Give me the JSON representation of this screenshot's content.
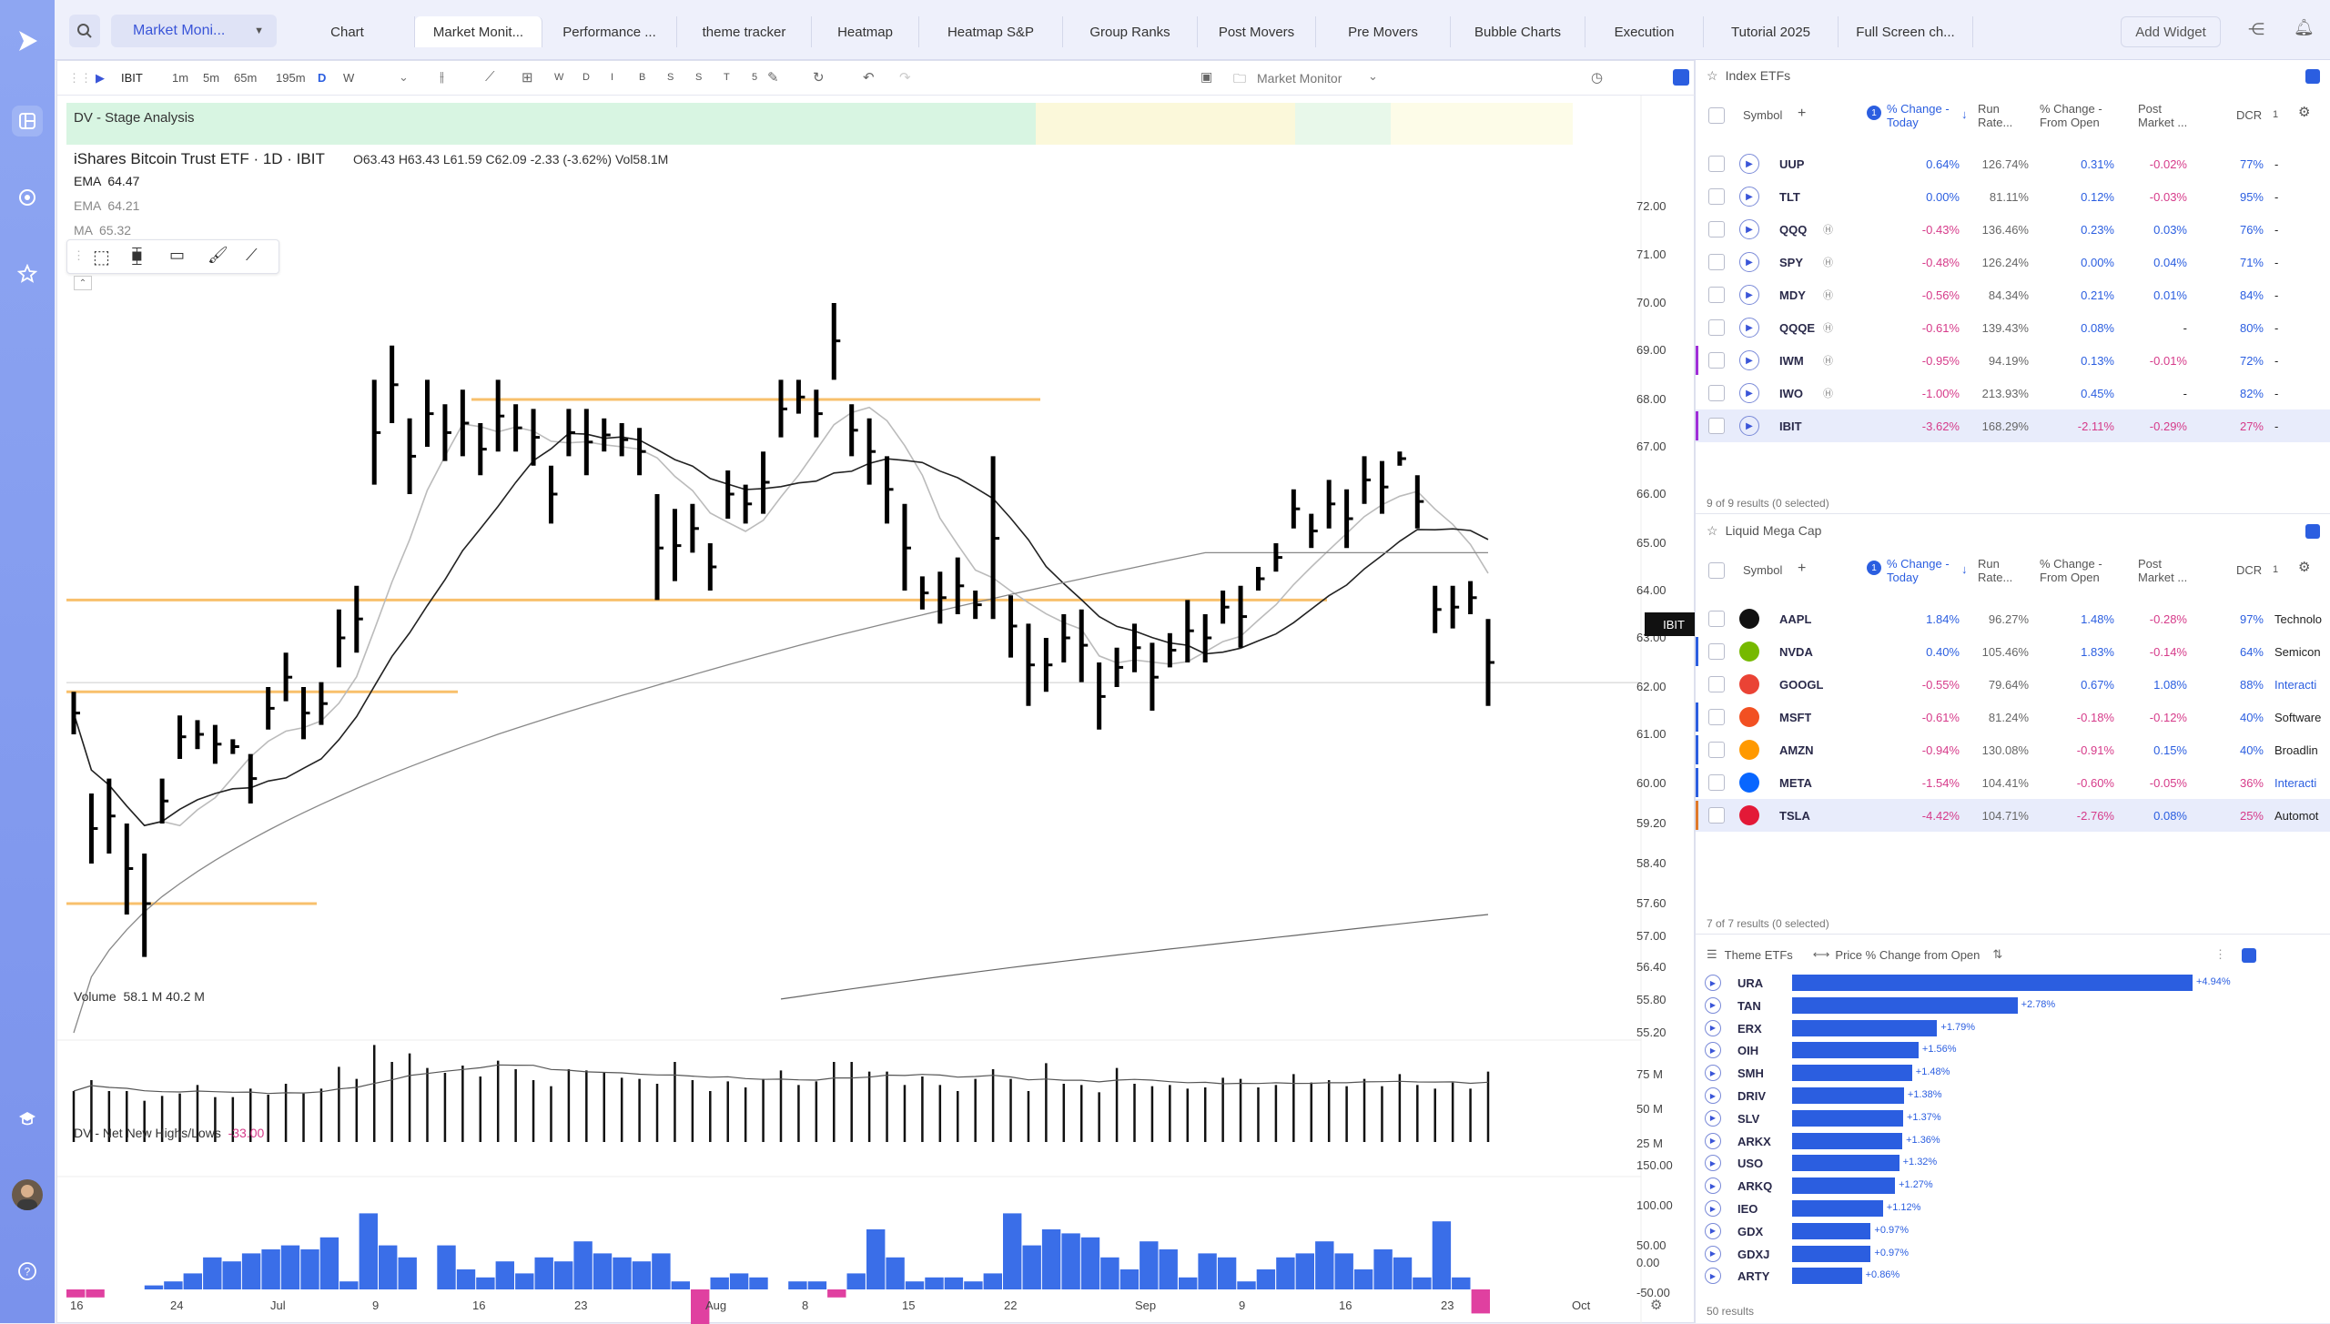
{
  "sidebar": {
    "logo": "play-logo-icon",
    "items": [
      "dashboard-icon",
      "target-icon",
      "star-icon",
      "graduation-cap-icon",
      "avatar",
      "help-icon"
    ]
  },
  "topbar": {
    "layout_selector": "Market Moni...",
    "tabs": [
      "Chart",
      "Market Monit...",
      "Performance ...",
      "theme tracker",
      "Heatmap",
      "Heatmap S&P",
      "Group Ranks",
      "Post Movers",
      "Pre Movers",
      "Bubble Charts",
      "Execution",
      "Tutorial 2025",
      "Full Screen ch..."
    ],
    "active_tab": "Market Monit...",
    "add_widget": "Add Widget"
  },
  "chart": {
    "toolbar": {
      "symbol": "IBIT",
      "intervals": [
        "1m",
        "5m",
        "65m",
        "195m",
        "D",
        "W"
      ],
      "active_interval": "D",
      "tool_letters": [
        "W",
        "D",
        "I",
        "B",
        "S",
        "S",
        "T",
        "5"
      ],
      "layout_name": "Market Monitor"
    },
    "stage_label": "DV - Stage Analysis",
    "title": "iShares Bitcoin Trust ETF · 1D · IBIT",
    "ohlc": "O63.43  H63.43  L61.59  C62.09  -2.33 (-3.62%)  Vol58.1M",
    "indicators": [
      {
        "name": "EMA",
        "value": "64.47"
      },
      {
        "name": "EMA",
        "value": "64.21"
      },
      {
        "name": "MA",
        "value": "65.32"
      }
    ],
    "price_tag": "IBIT",
    "y_axis": [
      "72.00",
      "71.00",
      "70.00",
      "69.00",
      "68.00",
      "67.00",
      "66.00",
      "65.00",
      "64.00",
      "63.00",
      "62.00",
      "61.00",
      "60.00",
      "59.20",
      "58.40",
      "57.60",
      "57.00",
      "56.40",
      "55.80",
      "55.20"
    ],
    "x_axis": [
      "16",
      "24",
      "Jul",
      "9",
      "16",
      "23",
      "Aug",
      "8",
      "15",
      "22",
      "Sep",
      "9",
      "16",
      "23",
      "Oct"
    ],
    "volume_label": "Volume",
    "volume_values": "58.1 M   40.2 M",
    "volume_axis": [
      "75 M",
      "50 M",
      "25 M"
    ],
    "nnh_label": "DV - Net New Highs/Lows",
    "nnh_value": "-33.00",
    "nnh_axis": [
      "150.00",
      "100.00",
      "50.00",
      "0.00",
      "-50.00"
    ]
  },
  "chart_data": {
    "type": "ohlc",
    "title": "iShares Bitcoin Trust ETF · 1D · IBIT",
    "y_range": [
      55.2,
      72
    ],
    "support_lines": [
      68.0,
      63.8,
      61.9,
      57.6
    ],
    "bars": [
      [
        61.9,
        61.0
      ],
      [
        59.8,
        58.4
      ],
      [
        60.1,
        58.6
      ],
      [
        59.2,
        57.4
      ],
      [
        58.6,
        56.6
      ],
      [
        60.1,
        59.2
      ],
      [
        61.4,
        60.5
      ],
      [
        61.3,
        60.7
      ],
      [
        61.2,
        60.4
      ],
      [
        60.9,
        60.6
      ],
      [
        60.6,
        59.6
      ],
      [
        62.0,
        61.1
      ],
      [
        62.7,
        61.7
      ],
      [
        62.0,
        60.9
      ],
      [
        62.1,
        61.2
      ],
      [
        63.6,
        62.4
      ],
      [
        64.1,
        62.7
      ],
      [
        68.4,
        66.2
      ],
      [
        69.1,
        67.5
      ],
      [
        67.6,
        66.0
      ],
      [
        68.4,
        67.0
      ],
      [
        67.9,
        66.7
      ],
      [
        68.2,
        66.8
      ],
      [
        67.5,
        66.4
      ],
      [
        68.4,
        66.9
      ],
      [
        67.9,
        66.9
      ],
      [
        67.8,
        66.6
      ],
      [
        66.6,
        65.4
      ],
      [
        67.8,
        66.8
      ],
      [
        67.8,
        66.4
      ],
      [
        67.6,
        66.9
      ],
      [
        67.5,
        66.8
      ],
      [
        67.4,
        66.4
      ],
      [
        66.0,
        63.8
      ],
      [
        65.7,
        64.2
      ],
      [
        65.8,
        64.8
      ],
      [
        65.0,
        64.0
      ],
      [
        66.5,
        65.5
      ],
      [
        66.2,
        65.4
      ],
      [
        66.9,
        65.6
      ],
      [
        68.4,
        67.2
      ],
      [
        68.4,
        67.7
      ],
      [
        68.2,
        67.2
      ],
      [
        70.0,
        68.4
      ],
      [
        67.9,
        66.8
      ],
      [
        67.6,
        66.2
      ],
      [
        66.8,
        65.4
      ],
      [
        65.8,
        64.0
      ],
      [
        64.3,
        63.6
      ],
      [
        64.4,
        63.3
      ],
      [
        64.7,
        63.5
      ],
      [
        64.0,
        63.4
      ],
      [
        66.8,
        63.4
      ],
      [
        63.9,
        62.6
      ],
      [
        63.3,
        61.6
      ],
      [
        63.0,
        61.9
      ],
      [
        63.5,
        62.5
      ],
      [
        63.6,
        62.1
      ],
      [
        62.5,
        61.1
      ],
      [
        62.8,
        62.0
      ],
      [
        63.3,
        62.3
      ],
      [
        62.9,
        61.5
      ],
      [
        63.1,
        62.4
      ],
      [
        63.8,
        62.5
      ],
      [
        63.5,
        62.5
      ],
      [
        64.0,
        63.3
      ],
      [
        64.1,
        62.8
      ],
      [
        64.5,
        64.0
      ],
      [
        65.0,
        64.4
      ],
      [
        66.1,
        65.3
      ],
      [
        65.6,
        64.9
      ],
      [
        66.3,
        65.3
      ],
      [
        66.1,
        64.9
      ],
      [
        66.8,
        65.8
      ],
      [
        66.7,
        65.6
      ],
      [
        66.9,
        66.6
      ],
      [
        66.4,
        65.3
      ],
      [
        64.1,
        63.1
      ],
      [
        64.1,
        63.2
      ],
      [
        64.2,
        63.5
      ],
      [
        63.4,
        61.6
      ]
    ],
    "volume": [
      42,
      51,
      42,
      42,
      34,
      38,
      40,
      47,
      37,
      37,
      44,
      39,
      48,
      40,
      44,
      62,
      52,
      80,
      66,
      73,
      61,
      57,
      63,
      54,
      67,
      60,
      51,
      46,
      60,
      59,
      57,
      53,
      52,
      48,
      66,
      51,
      42,
      50,
      45,
      52,
      59,
      47,
      50,
      66,
      66,
      58,
      58,
      47,
      54,
      47,
      42,
      52,
      60,
      52,
      42,
      65,
      48,
      47,
      41,
      61,
      48,
      46,
      47,
      44,
      45,
      53,
      52,
      45,
      47,
      56,
      49,
      51,
      46,
      52,
      46,
      56,
      47,
      44,
      49,
      44,
      58
    ],
    "net_new_highs": [
      -10,
      -10,
      0,
      0,
      5,
      10,
      20,
      40,
      35,
      45,
      50,
      55,
      50,
      65,
      10,
      95,
      55,
      40,
      0,
      55,
      25,
      15,
      35,
      20,
      40,
      35,
      60,
      45,
      40,
      35,
      45,
      10,
      -60,
      15,
      20,
      15,
      0,
      10,
      10,
      -10,
      20,
      75,
      40,
      10,
      15,
      15,
      10,
      20,
      95,
      55,
      75,
      70,
      65,
      40,
      25,
      60,
      50,
      15,
      45,
      40,
      10,
      25,
      40,
      45,
      60,
      45,
      25,
      50,
      40,
      15,
      85,
      15,
      -30
    ]
  },
  "index_etfs": {
    "title": "Index ETFs",
    "columns": [
      "Symbol",
      "% Change - Today",
      "Run Rate...",
      "% Change - From Open",
      "Post Market ...",
      "DCR",
      "1"
    ],
    "rows": [
      {
        "sym": "UUP",
        "chg": "0.64%",
        "run": "126.74%",
        "open": "0.31%",
        "post": "-0.02%",
        "dcr": "77%",
        "extra": "-",
        "badge": false
      },
      {
        "sym": "TLT",
        "chg": "0.00%",
        "run": "81.11%",
        "open": "0.12%",
        "post": "-0.03%",
        "dcr": "95%",
        "extra": "-",
        "badge": false
      },
      {
        "sym": "QQQ",
        "chg": "-0.43%",
        "run": "136.46%",
        "open": "0.23%",
        "post": "0.03%",
        "dcr": "76%",
        "extra": "-",
        "badge": true
      },
      {
        "sym": "SPY",
        "chg": "-0.48%",
        "run": "126.24%",
        "open": "0.00%",
        "post": "0.04%",
        "dcr": "71%",
        "extra": "-",
        "badge": true
      },
      {
        "sym": "MDY",
        "chg": "-0.56%",
        "run": "84.34%",
        "open": "0.21%",
        "post": "0.01%",
        "dcr": "84%",
        "extra": "-",
        "badge": true
      },
      {
        "sym": "QQQE",
        "chg": "-0.61%",
        "run": "139.43%",
        "open": "0.08%",
        "post": "-",
        "dcr": "80%",
        "extra": "-",
        "badge": true
      },
      {
        "sym": "IWM",
        "chg": "-0.95%",
        "run": "94.19%",
        "open": "0.13%",
        "post": "-0.01%",
        "dcr": "72%",
        "extra": "-",
        "badge": true
      },
      {
        "sym": "IWO",
        "chg": "-1.00%",
        "run": "213.93%",
        "open": "0.45%",
        "post": "-",
        "dcr": "82%",
        "extra": "-",
        "badge": true
      },
      {
        "sym": "IBIT",
        "chg": "-3.62%",
        "run": "168.29%",
        "open": "-2.11%",
        "post": "-0.29%",
        "dcr": "27%",
        "extra": "-",
        "badge": false
      }
    ],
    "footer": "9 of 9 results (0 selected)"
  },
  "mega_cap": {
    "title": "Liquid Mega Cap",
    "columns": [
      "Symbol",
      "% Change - Today",
      "Run Rate...",
      "% Change - From Open",
      "Post Market ...",
      "DCR",
      "1"
    ],
    "rows": [
      {
        "sym": "AAPL",
        "chg": "1.84%",
        "run": "96.27%",
        "open": "1.48%",
        "post": "-0.28%",
        "dcr": "97%",
        "extra": "Technolo",
        "logo": "#111"
      },
      {
        "sym": "NVDA",
        "chg": "0.40%",
        "run": "105.46%",
        "open": "1.83%",
        "post": "-0.14%",
        "dcr": "64%",
        "extra": "Semicon",
        "logo": "#76b900"
      },
      {
        "sym": "GOOGL",
        "chg": "-0.55%",
        "run": "79.64%",
        "open": "0.67%",
        "post": "1.08%",
        "dcr": "88%",
        "extra": "Interacti",
        "logo": "#ea4335"
      },
      {
        "sym": "MSFT",
        "chg": "-0.61%",
        "run": "81.24%",
        "open": "-0.18%",
        "post": "-0.12%",
        "dcr": "40%",
        "extra": "Software",
        "logo": "#f25022"
      },
      {
        "sym": "AMZN",
        "chg": "-0.94%",
        "run": "130.08%",
        "open": "-0.91%",
        "post": "0.15%",
        "dcr": "40%",
        "extra": "Broadlin",
        "logo": "#ff9900"
      },
      {
        "sym": "META",
        "chg": "-1.54%",
        "run": "104.41%",
        "open": "-0.60%",
        "post": "-0.05%",
        "dcr": "36%",
        "extra": "Interacti",
        "logo": "#0866ff"
      },
      {
        "sym": "TSLA",
        "chg": "-4.42%",
        "run": "104.71%",
        "open": "-2.76%",
        "post": "0.08%",
        "dcr": "25%",
        "extra": "Automot",
        "logo": "#e31937"
      }
    ],
    "footer": "7 of 7 results (0 selected)"
  },
  "theme_etfs": {
    "title": "Theme ETFs",
    "sort": "Price % Change from Open",
    "rows": [
      {
        "sym": "URA",
        "val": 4.94,
        "label": "+4.94%"
      },
      {
        "sym": "TAN",
        "val": 2.78,
        "label": "+2.78%"
      },
      {
        "sym": "ERX",
        "val": 1.79,
        "label": "+1.79%"
      },
      {
        "sym": "OIH",
        "val": 1.56,
        "label": "+1.56%"
      },
      {
        "sym": "SMH",
        "val": 1.48,
        "label": "+1.48%"
      },
      {
        "sym": "DRIV",
        "val": 1.38,
        "label": "+1.38%"
      },
      {
        "sym": "SLV",
        "val": 1.37,
        "label": "+1.37%"
      },
      {
        "sym": "ARKX",
        "val": 1.36,
        "label": "+1.36%"
      },
      {
        "sym": "USO",
        "val": 1.32,
        "label": "+1.32%"
      },
      {
        "sym": "ARKQ",
        "val": 1.27,
        "label": "+1.27%"
      },
      {
        "sym": "IEO",
        "val": 1.12,
        "label": "+1.12%"
      },
      {
        "sym": "GDX",
        "val": 0.97,
        "label": "+0.97%"
      },
      {
        "sym": "GDXJ",
        "val": 0.97,
        "label": "+0.97%"
      },
      {
        "sym": "ARTY",
        "val": 0.86,
        "label": "+0.86%"
      }
    ],
    "footer": "50 results"
  },
  "colors": {
    "accent": "#2b5ee0",
    "negative": "#d63b8a",
    "support": "#f8c06c",
    "bar": "#3a6ee8"
  }
}
